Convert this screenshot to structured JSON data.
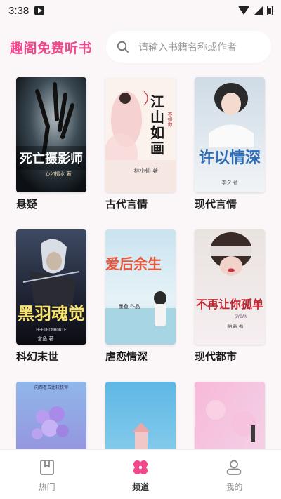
{
  "status_bar": {
    "time": "3:38"
  },
  "header": {
    "title": "趣阁免费听书",
    "search_placeholder": "请输入书籍名称或作者"
  },
  "categories": [
    {
      "label": "悬疑",
      "cover_title": "死亡摄影师",
      "cover_author": "心如擂水 著"
    },
    {
      "label": "古代言情",
      "cover_title": "江山如画",
      "cover_subtitle": "不如你",
      "cover_author": "林小仙 著"
    },
    {
      "label": "现代言情",
      "cover_title": "许以情深",
      "cover_author": "季夕 著"
    },
    {
      "label": "科幻末世",
      "cover_title": "黑羽魂觉",
      "cover_author": "言鱼 著",
      "cover_extra": "HEETHOMHONIE"
    },
    {
      "label": "虐恋情深",
      "cover_title": "爱后余生",
      "cover_author": "墨鱼 作品"
    },
    {
      "label": "现代都市",
      "cover_title": "不再让你孤单",
      "cover_author": "陌离 著",
      "cover_extra": "GYDAN"
    },
    {
      "label": "",
      "cover_title": "",
      "cover_top": "向西看去比较快得"
    },
    {
      "label": "",
      "cover_title": ""
    },
    {
      "label": "",
      "cover_title": ""
    }
  ],
  "nav": [
    {
      "label": "热门",
      "icon": "bookmark-book-icon"
    },
    {
      "label": "频道",
      "icon": "clover-icon"
    },
    {
      "label": "我的",
      "icon": "person-icon"
    }
  ],
  "colors": {
    "accent": "#f2478b",
    "background": "#fbf7f9"
  }
}
